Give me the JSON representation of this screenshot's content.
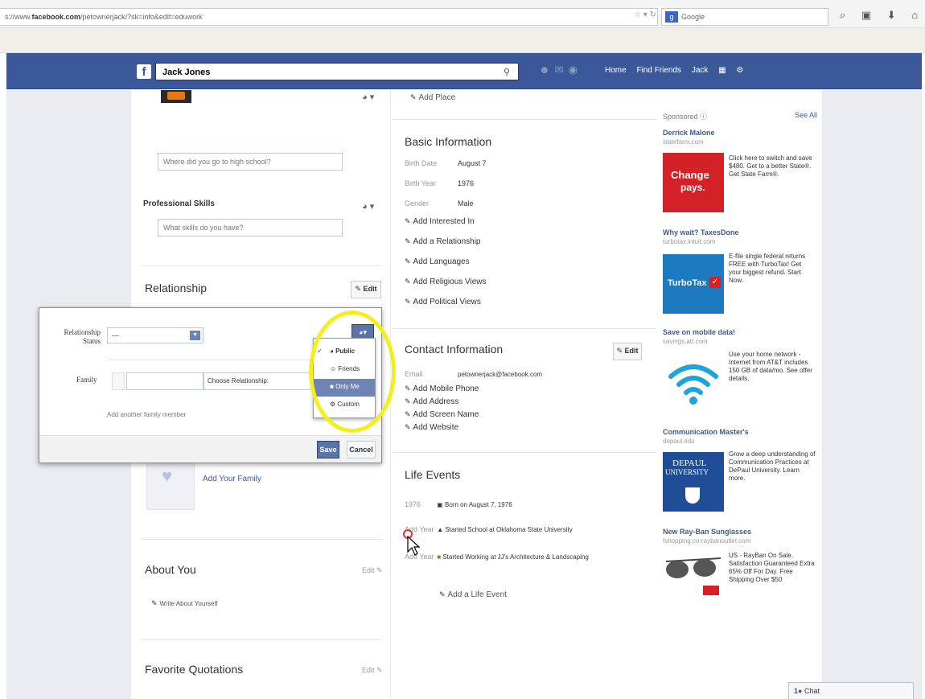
{
  "browser": {
    "url_prefix": "s://www.",
    "url_domain": "facebook.com",
    "url_rest": "/petownerjack/?sk=info&edit=eduwork",
    "search_engine": "Google",
    "search_engine_icon": "google-icon"
  },
  "fb_header": {
    "search_value": "Jack Jones",
    "nav": {
      "home": "Home",
      "find_friends": "Find Friends",
      "user": "Jack"
    }
  },
  "left": {
    "high_school_placeholder": "Where did you go to high school?",
    "professional_skills_title": "Professional Skills",
    "professional_skills_placeholder": "What skills do you have?",
    "relationship_title": "Relationship",
    "edit_label": "Edit",
    "add_family": "Add Your Family",
    "about_you_title": "About You",
    "about_edit": "Edit",
    "write_about": "Write About Yourself",
    "quotations_title": "Favorite Quotations",
    "quotations_edit": "Edit"
  },
  "rel_editor": {
    "status_label_1": "Relationship",
    "status_label_2": "Status",
    "status_value": "---",
    "family_label": "Family",
    "choose_relationship": "Choose Relationship:",
    "add_another": "Add another family member",
    "save": "Save",
    "cancel": "Cancel",
    "privacy_options": [
      "Public",
      "Friends",
      "Only Me",
      "Custom"
    ],
    "privacy_selected": "Only Me"
  },
  "mid": {
    "add_place": "Add Place",
    "basic_info_title": "Basic Information",
    "basic_rows": [
      {
        "label": "Birth Date",
        "value": "August 7"
      },
      {
        "label": "Birth Year",
        "value": "1976"
      },
      {
        "label": "Gender",
        "value": "Male"
      }
    ],
    "basic_links": [
      "Add Interested In",
      "Add a Relationship",
      "Add Languages",
      "Add Religious Views",
      "Add Political Views"
    ],
    "contact_title": "Contact Information",
    "contact_edit": "Edit",
    "email_label": "Email",
    "email_value": "petownerjack@facebook.com",
    "contact_links": [
      "Add Mobile Phone",
      "Add Address",
      "Add Screen Name",
      "Add Website"
    ],
    "life_title": "Life Events",
    "life_events": [
      {
        "year": "1976",
        "text": "Born on August 7, 1976"
      },
      {
        "year": "Add Year",
        "text": "Started School at Oklahoma State University"
      },
      {
        "year": "Add Year",
        "text": "Started Working at JJ's Architecture & Landscaping"
      }
    ],
    "add_life_event": "Add a Life Event"
  },
  "ads": {
    "sponsored": "Sponsored",
    "see_all": "See All",
    "items": [
      {
        "title": "Derrick Malone",
        "url": "statefarm.com",
        "img_text_1": "Change",
        "img_text_2": "pays.",
        "body": "Click here to switch and save $480. Get to a better State®. Get State Farm®."
      },
      {
        "title": "Why wait? TaxesDone",
        "url": "turbotax.intuit.com",
        "img_text_1": "TurboTax",
        "body": "E-file single federal returns FREE with TurboTax! Get your biggest refund. Start Now."
      },
      {
        "title": "Save on mobile data!",
        "url": "savings.att.com",
        "body": "Use your home network - Internet from AT&T includes 150 GB of data/mo. See offer details."
      },
      {
        "title": "Communication Master's",
        "url": "depaul.edu",
        "img_text_1": "DEPAUL",
        "img_text_2": "UNIVERSITY",
        "body": "Grow a deep understanding of Communication Practices at DePaul University. Learn more."
      },
      {
        "title": "New Ray-Ban Sunglasses",
        "url": "fshopping.co-raybanoutlet.com",
        "body": "US - RayBan On Sale, Satisfaction Guaranteed Extra 65% Off For Day. Free Shipping Over $50"
      }
    ]
  },
  "chat": {
    "label": "Chat",
    "count": "1"
  },
  "colors": {
    "fb_blue": "#3b5998",
    "highlight": "#f2ef1e",
    "statefarm_red": "#d42127",
    "turbotax_blue": "#1d7ac0",
    "depaul_blue": "#1f4e96"
  }
}
